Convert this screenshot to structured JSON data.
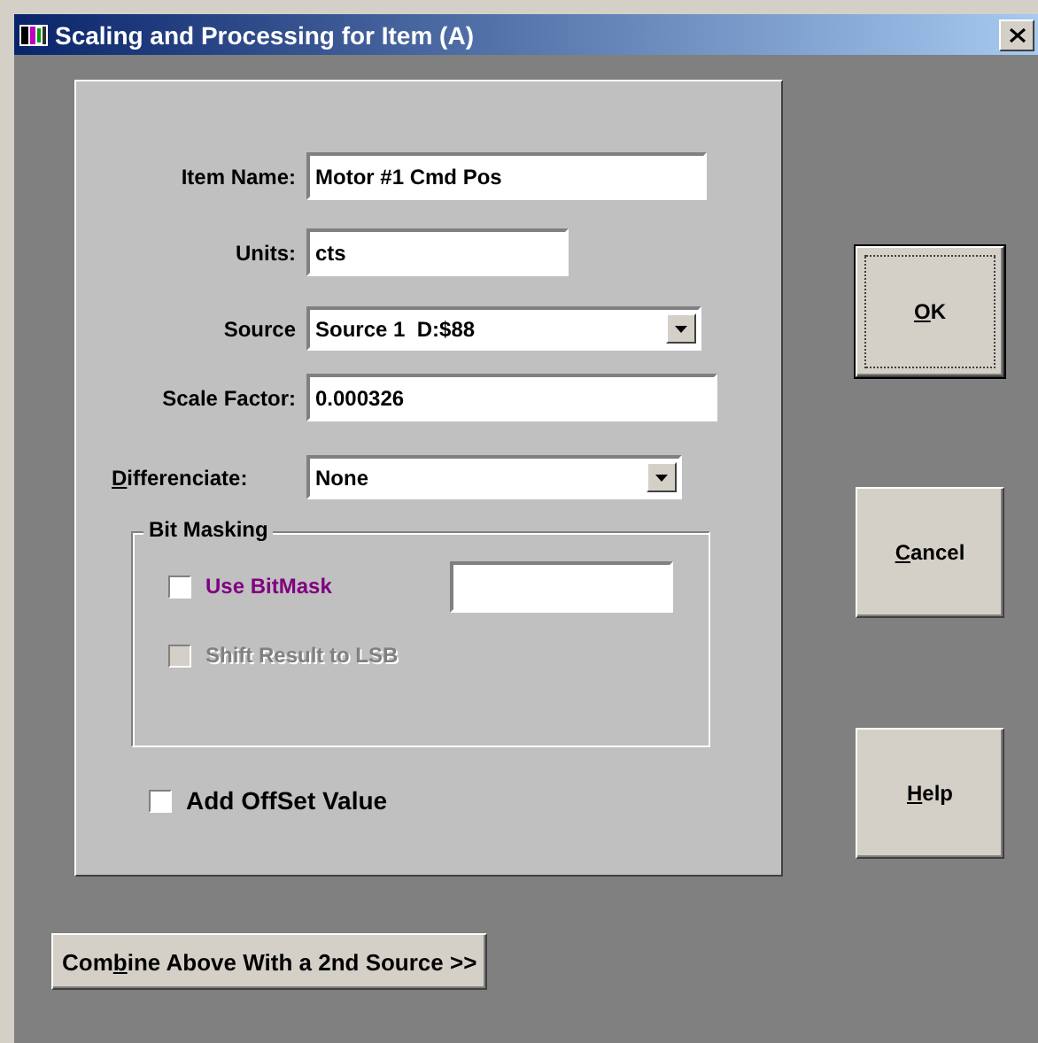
{
  "window": {
    "title": "Scaling and Processing for Item (A)"
  },
  "fields": [
    {
      "kind": "text",
      "label_parts": [
        {
          "text": "Item Name:",
          "underlined": false
        }
      ],
      "value": "Motor #1 Cmd Pos"
    },
    {
      "kind": "text",
      "label_parts": [
        {
          "text": "Units:",
          "underlined": false
        }
      ],
      "value": "cts"
    },
    {
      "kind": "select",
      "label_parts": [
        {
          "text": "Source",
          "underlined": false
        }
      ],
      "value": "Source 1  D:$88"
    },
    {
      "kind": "text",
      "label_parts": [
        {
          "text": "Scale Factor:",
          "underlined": false
        }
      ],
      "value": "0.000326"
    },
    {
      "kind": "select",
      "label_parts": [
        {
          "text": "D",
          "underlined": true
        },
        {
          "text": "ifferenciate:",
          "underlined": false
        }
      ],
      "value": "None"
    }
  ],
  "bit_masking": {
    "title": "Bit Masking",
    "options": [
      {
        "label": "Use BitMask",
        "checked": false,
        "disabled": false,
        "color": "#800080"
      },
      {
        "label": "Shift Result to LSB",
        "checked": false,
        "disabled": true,
        "color": "#808080"
      }
    ]
  },
  "offset": {
    "label": "Add OffSet Value",
    "checked": false
  },
  "combine_button": {
    "label_parts": [
      {
        "text": "Com",
        "underlined": false
      },
      {
        "text": "b",
        "underlined": true
      },
      {
        "text": "ine Above With a 2nd Source >>",
        "underlined": false
      }
    ]
  },
  "buttons": [
    {
      "label_parts": [
        {
          "text": "O",
          "underlined": true
        },
        {
          "text": "K",
          "underlined": false
        }
      ],
      "default": true
    },
    {
      "label_parts": [
        {
          "text": "C",
          "underlined": true
        },
        {
          "text": "ancel",
          "underlined": false
        }
      ],
      "default": false
    },
    {
      "label_parts": [
        {
          "text": "H",
          "underlined": true
        },
        {
          "text": "elp",
          "underlined": false
        }
      ],
      "default": false
    }
  ]
}
